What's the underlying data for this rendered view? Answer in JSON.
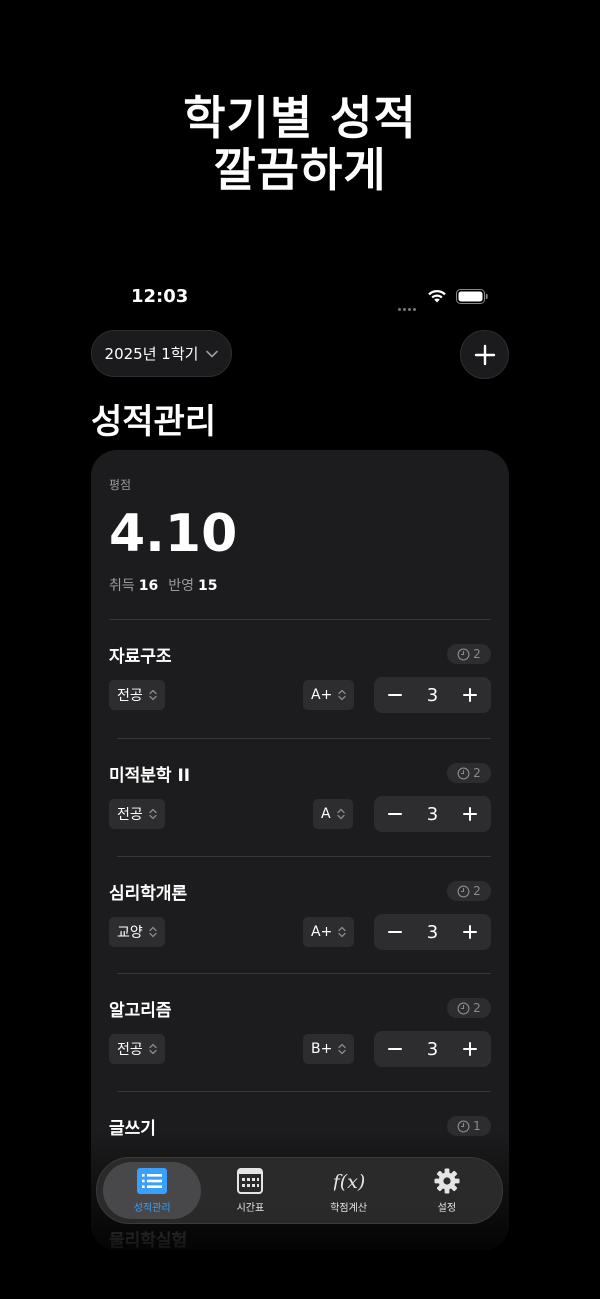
{
  "headline": {
    "line1": "학기별 성적",
    "line2": "깔끔하게"
  },
  "status_bar": {
    "time": "12:03"
  },
  "semester_selector": {
    "label": "2025년 1학기"
  },
  "page_title": "성적관리",
  "summary": {
    "gpa_label": "평점",
    "gpa_value": "4.10",
    "earned_label": "취득",
    "earned_value": "16",
    "applied_label": "반영",
    "applied_value": "15"
  },
  "courses": [
    {
      "name": "자료구조",
      "badge_count": "2",
      "type": "전공",
      "grade": "A+",
      "credits": "3"
    },
    {
      "name": "미적분학 II",
      "badge_count": "2",
      "type": "전공",
      "grade": "A",
      "credits": "3"
    },
    {
      "name": "심리학개론",
      "badge_count": "2",
      "type": "교양",
      "grade": "A+",
      "credits": "3"
    },
    {
      "name": "알고리즘",
      "badge_count": "2",
      "type": "전공",
      "grade": "B+",
      "credits": "3"
    },
    {
      "name": "글쓰기",
      "badge_count": "1"
    },
    {
      "name": "물리학실험"
    }
  ],
  "stepper": {
    "minus": "−",
    "plus": "+"
  },
  "tabs": [
    {
      "label": "성적관리",
      "icon": "list-icon",
      "active": true
    },
    {
      "label": "시간표",
      "icon": "calendar-icon",
      "active": false
    },
    {
      "label": "학점계산",
      "icon": "function-icon",
      "active": false
    },
    {
      "label": "설정",
      "icon": "gear-icon",
      "active": false
    }
  ],
  "colors": {
    "accent": "#3aa0ff",
    "card": "#1c1c1e",
    "control": "#2d2d30"
  }
}
